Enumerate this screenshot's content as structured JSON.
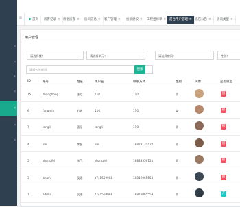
{
  "tabs": [
    {
      "label": "首页",
      "current": false
    },
    {
      "label": "房客记录",
      "current": false
    },
    {
      "label": "待退房客",
      "current": false
    },
    {
      "label": "房间信息",
      "current": false
    },
    {
      "label": "客户管理",
      "current": false
    },
    {
      "label": "投诉建议",
      "current": false
    },
    {
      "label": "工程维修单",
      "current": false
    },
    {
      "label": "前台用户管理",
      "current": true
    },
    {
      "label": "酒店公告",
      "current": false
    },
    {
      "label": "房间类型",
      "current": false
    }
  ],
  "panel": {
    "title": "用户管理",
    "filters": [
      "请选择楼！",
      "请选择单元！",
      "请选择房间！",
      "性别！"
    ],
    "search_placeholder": "请输入关键词",
    "search_button": "搜索"
  },
  "table": {
    "headers": [
      "ID",
      "帐号",
      "姓名",
      "用户名",
      "联系方式",
      "性别",
      "头像",
      "是否锁定"
    ],
    "rows": [
      {
        "id": "15",
        "account": "zhanghong",
        "name": "张红",
        "username": "110",
        "contact": "110",
        "gender": "男",
        "avatar_bg": "#c9a27e",
        "lock": "锁",
        "lock_color": "#ed5565"
      },
      {
        "id": "6",
        "account": "fangmin",
        "name": "方敏",
        "username": "110",
        "contact": "110",
        "gender": "女",
        "avatar_bg": "#b78a6e",
        "lock": "锁",
        "lock_color": "#ed5565"
      },
      {
        "id": "7",
        "account": "tangli",
        "name": "唐丽",
        "username": "tangli",
        "contact": "110",
        "gender": "男",
        "avatar_bg": "#8d6a5a",
        "lock": "锁",
        "lock_color": "#ed5565"
      },
      {
        "id": "4",
        "account": "lilei",
        "name": "李磊",
        "username": "lilei",
        "contact": "18823131427",
        "gender": "男",
        "avatar_bg": "#7a5c48",
        "lock": "锁",
        "lock_color": "#ed5565"
      },
      {
        "id": "5",
        "account": "zhangfei",
        "name": "张飞",
        "username": "zhangfei",
        "contact": "18888556121",
        "gender": "男",
        "avatar_bg": "#9a7a63",
        "lock": "锁",
        "lock_color": "#ed5565"
      },
      {
        "id": "3",
        "account": "zzxcn",
        "name": "侯娜",
        "username": "z741559988",
        "contact": "18810065553",
        "gender": "男",
        "avatar_bg": "#3a4652",
        "lock": "锁",
        "lock_color": "#ed5565"
      },
      {
        "id": "1",
        "account": "admin",
        "name": "侯娜",
        "username": "z741559988",
        "contact": "18810065553",
        "gender": "男",
        "avatar_bg": "#2f3b45",
        "lock": "开",
        "lock_color": "#23c6c8"
      }
    ]
  }
}
